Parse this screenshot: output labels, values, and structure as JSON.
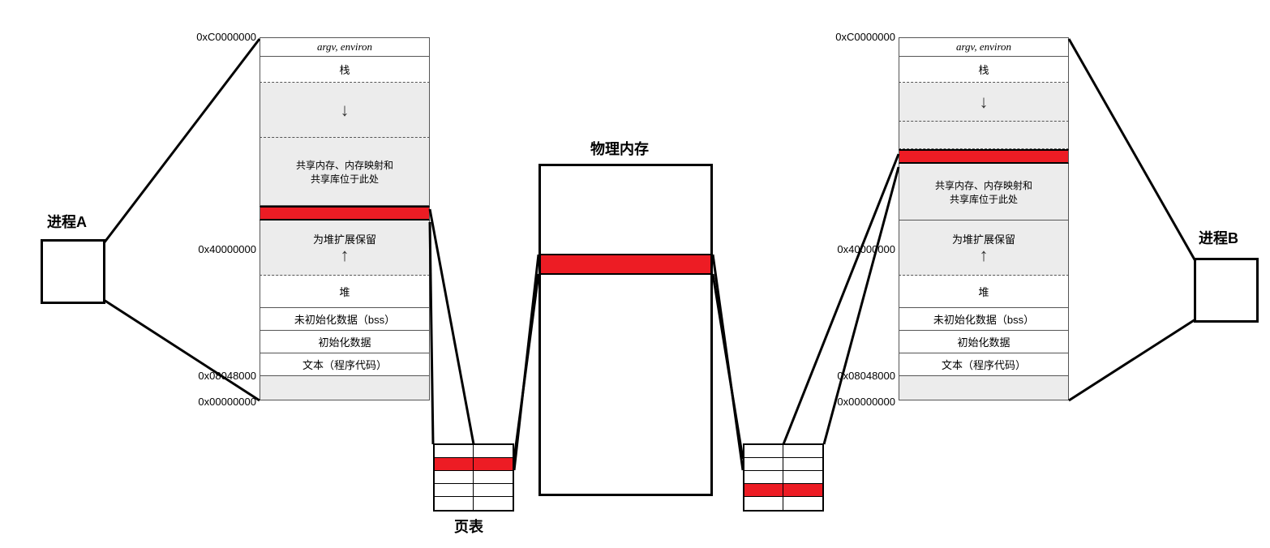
{
  "labels": {
    "process_a": "进程A",
    "process_b": "进程B",
    "physical_memory": "物理内存",
    "page_table": "页表"
  },
  "addresses": {
    "top": "0xC0000000",
    "mid": "0x40000000",
    "text_base": "0x08048000",
    "zero": "0x00000000"
  },
  "segments": {
    "argv": "argv, environ",
    "stack": "栈",
    "mmap_line1": "共享内存、内存映射和",
    "mmap_line2": "共享库位于此处",
    "heap_reserve": "为堆扩展保留",
    "heap": "堆",
    "bss": "未初始化数据（bss）",
    "data": "初始化数据",
    "text": "文本（程序代码）"
  }
}
